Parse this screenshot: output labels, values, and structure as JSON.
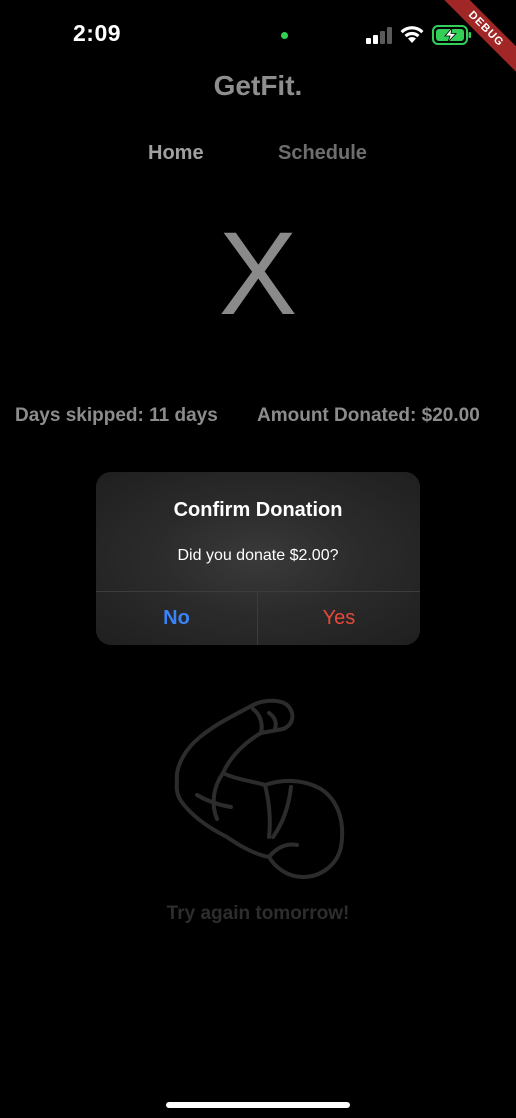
{
  "status_bar": {
    "time": "2:09",
    "debug_label": "DEBUG"
  },
  "app": {
    "title": "GetFit.",
    "tabs": [
      {
        "label": "Home",
        "active": true
      },
      {
        "label": "Schedule",
        "active": false
      }
    ],
    "status_symbol": "X",
    "days_skipped": "Days skipped: 11 days",
    "amount_donated": "Amount Donated: $20.00",
    "footer_message": "Try again tomorrow!",
    "icon": "flexed-arm-icon"
  },
  "dialog": {
    "title": "Confirm Donation",
    "message": "Did you donate $2.00?",
    "no_label": "No",
    "yes_label": "Yes"
  },
  "colors": {
    "no_button": "#3a82f7",
    "yes_button": "#e5493a",
    "battery_green": "#33d058",
    "debug_ribbon": "#a12727"
  }
}
